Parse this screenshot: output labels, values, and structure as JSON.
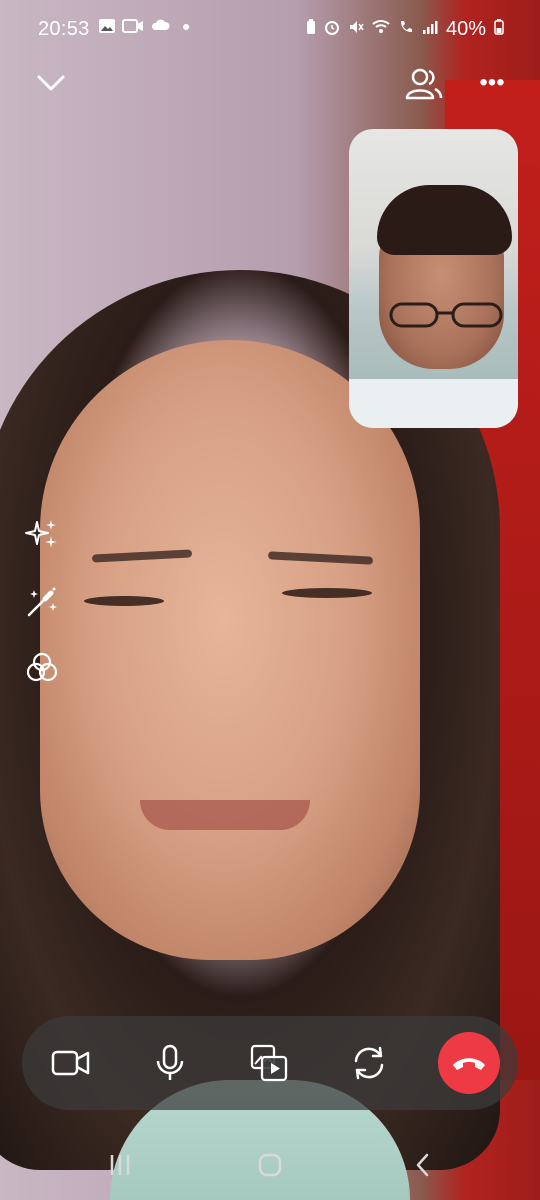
{
  "status_bar": {
    "time": "20:53",
    "left_icons": [
      "gallery-icon",
      "video-icon",
      "cloud-icon",
      "dot-icon"
    ],
    "right_icons": [
      "battery-saver-icon",
      "alarm-icon",
      "mute-icon",
      "wifi-call-icon",
      "volte-icon",
      "signal-icon"
    ],
    "battery": "40%"
  },
  "top_bar": {
    "collapse_icon": "chevron-down-icon",
    "participants_icon": "people-icon",
    "more_label": "•••"
  },
  "side_tools": [
    {
      "name": "effects-sparkle-icon"
    },
    {
      "name": "magic-wand-icon"
    },
    {
      "name": "filters-circles-icon"
    }
  ],
  "controls": [
    {
      "name": "camera-toggle",
      "icon": "video-camera-icon"
    },
    {
      "name": "mic-toggle",
      "icon": "microphone-icon"
    },
    {
      "name": "share-media",
      "icon": "media-share-icon"
    },
    {
      "name": "flip-camera",
      "icon": "switch-camera-icon"
    },
    {
      "name": "end-call",
      "icon": "phone-hangup-icon",
      "color": "#ee3a45"
    }
  ],
  "nav_bar": [
    "recent-apps-icon",
    "home-icon",
    "back-icon"
  ]
}
